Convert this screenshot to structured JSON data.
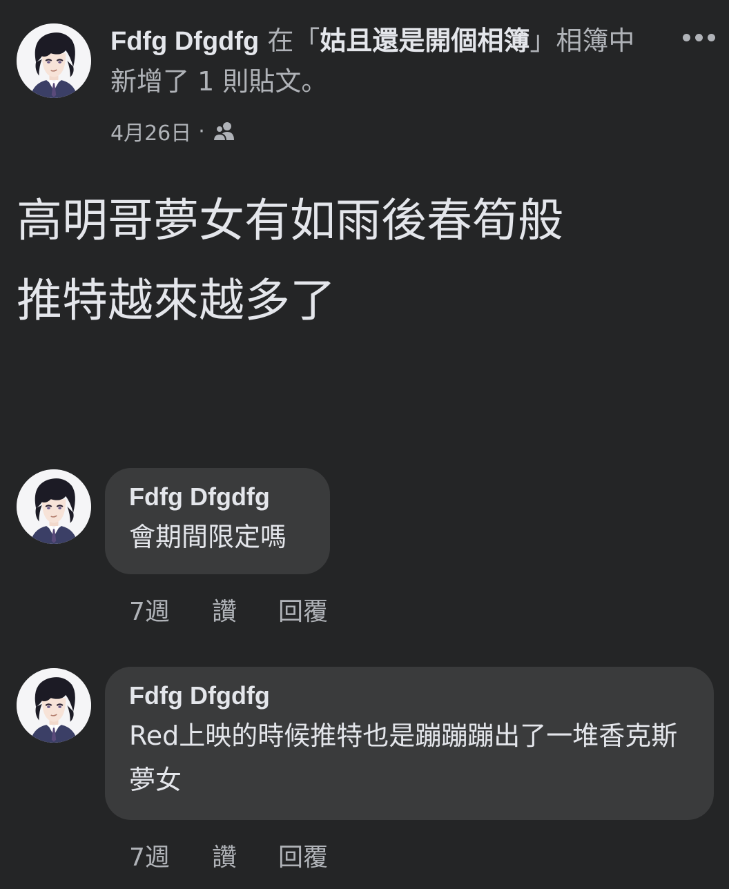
{
  "post": {
    "author": "Fdfg Dfgdfg",
    "action_prefix": " 在「",
    "album_name": "姑且還是開個相簿",
    "action_suffix": "」相簿中新增了 1 則貼文。",
    "date": "4月26日",
    "separator": "·",
    "audience_icon": "friends-icon",
    "more_icon": "more-options-icon",
    "text": "高明哥夢女有如雨後春筍般\n推特越來越多了"
  },
  "comments": [
    {
      "author": "Fdfg Dfgdfg",
      "text": "會期間限定嗎",
      "time": "7週",
      "like_label": "讚",
      "reply_label": "回覆"
    },
    {
      "author": "Fdfg Dfgdfg",
      "text": "Red上映的時候推特也是蹦蹦蹦出了一堆香克斯夢女",
      "time": "7週",
      "like_label": "讚",
      "reply_label": "回覆"
    }
  ],
  "colors": {
    "background": "#242526",
    "bubble": "#3a3b3c",
    "primary_text": "#e4e6eb",
    "secondary_text": "#b0b3b8"
  }
}
